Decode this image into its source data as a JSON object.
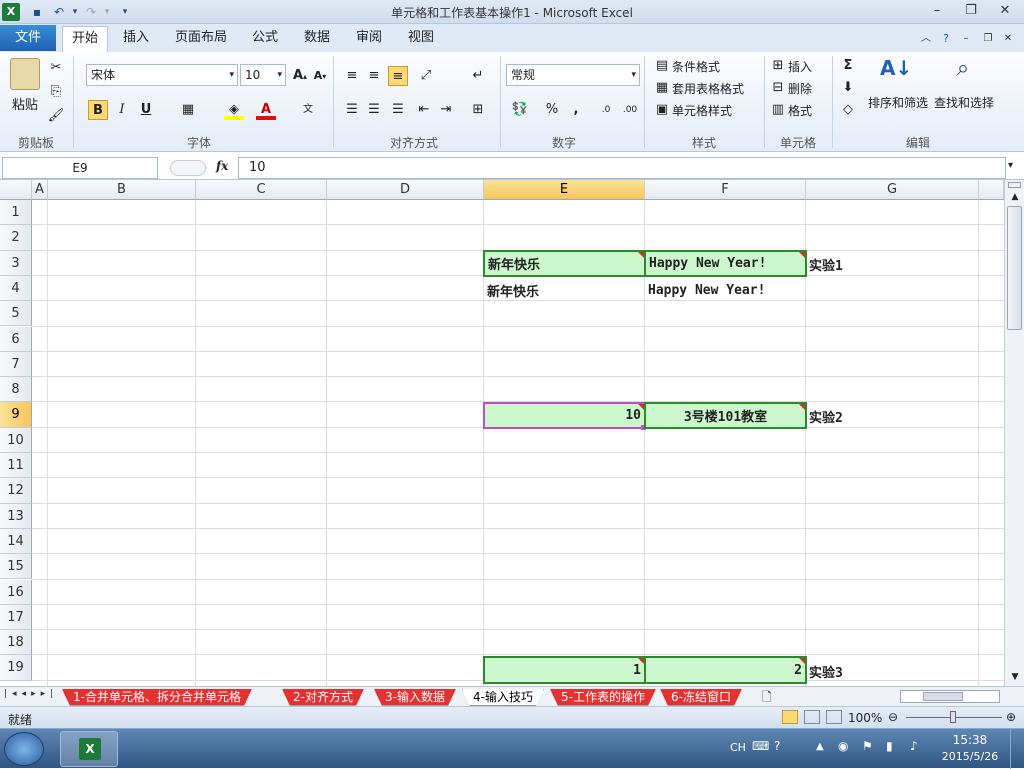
{
  "window": {
    "title": "单元格和工作表基本操作1  -  Microsoft Excel"
  },
  "colors": {
    "accent": "#1f62b4",
    "cell_fill": "#ccf7cc",
    "cell_border": "#2b8a2b",
    "selected_header": "#f6c65a",
    "comment_marker": "#c0392b"
  },
  "ribbon": {
    "file_tab": "文件",
    "tabs": [
      "开始",
      "插入",
      "页面布局",
      "公式",
      "数据",
      "审阅",
      "视图"
    ],
    "active_tab": "开始",
    "clipboard": {
      "paste": "粘贴",
      "group": "剪贴板"
    },
    "font": {
      "name": "宋体",
      "size": "10",
      "bold": "B",
      "italic": "I",
      "underline": "U",
      "font_color": "A",
      "group": "字体"
    },
    "alignment": {
      "group": "对齐方式"
    },
    "number": {
      "format": "常规",
      "percent": "%",
      "comma": ",",
      "group": "数字"
    },
    "styles": {
      "conditional": "条件格式",
      "table": "套用表格格式",
      "cell_styles": "单元格样式",
      "group": "样式"
    },
    "cells": {
      "insert": "插入",
      "delete": "删除",
      "format": "格式",
      "group": "单元格"
    },
    "editing": {
      "sort": "排序和筛选",
      "find": "查找和选择",
      "sum": "Σ",
      "group": "编辑"
    }
  },
  "formula_bar": {
    "name_box": "E9",
    "fx": "fx",
    "value": "10"
  },
  "columns": [
    "A",
    "B",
    "C",
    "D",
    "E",
    "F",
    "G"
  ],
  "selected_column": "E",
  "rows": [
    "1",
    "2",
    "3",
    "4",
    "5",
    "6",
    "7",
    "8",
    "9",
    "10",
    "11",
    "12",
    "13",
    "14",
    "15",
    "16",
    "17",
    "18",
    "19"
  ],
  "selected_row": "9",
  "cells": {
    "e3": "新年快乐",
    "f3": "Happy New Year!",
    "g3": "实验1",
    "e4": "新年快乐",
    "f4": "Happy New Year!",
    "e9": "10",
    "f9": "3号楼101教室",
    "g9": "实验2",
    "e19": "1",
    "f19": "2",
    "g19": "实验3"
  },
  "sheets": [
    "1-合并单元格、拆分合并单元格",
    "2-对齐方式",
    "3-输入数据",
    "4-输入技巧",
    "5-工作表的操作",
    "6-冻结窗口"
  ],
  "active_sheet": "4-输入技巧",
  "status": {
    "ready": "就绪",
    "zoom": "100%"
  },
  "taskbar": {
    "lang": "CH",
    "time": "15:38",
    "date": "2015/5/26"
  }
}
